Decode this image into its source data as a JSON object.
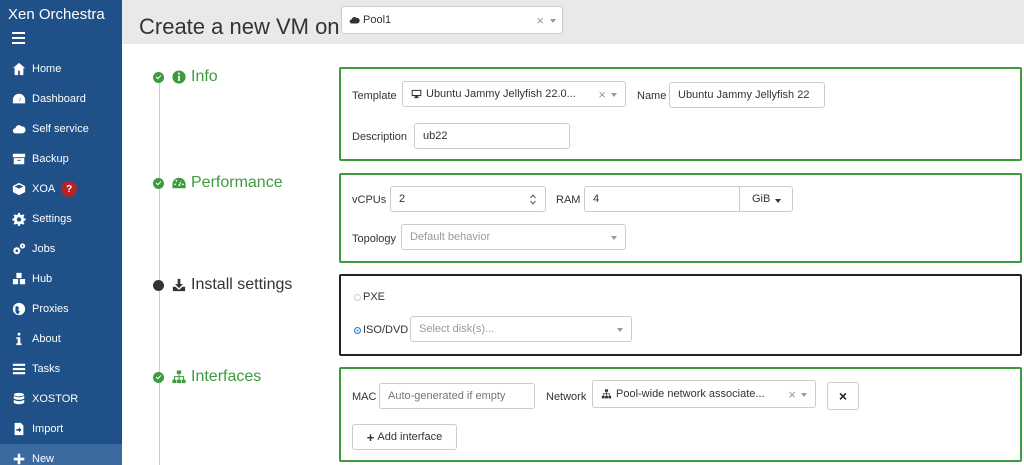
{
  "app": {
    "brand": "Xen Orchestra"
  },
  "sidebar": {
    "items": [
      {
        "label": "Home",
        "icon": "home-icon"
      },
      {
        "label": "Dashboard",
        "icon": "dashboard-icon"
      },
      {
        "label": "Self service",
        "icon": "cloud-icon"
      },
      {
        "label": "Backup",
        "icon": "archive-icon"
      },
      {
        "label": "XOA",
        "icon": "cube-icon",
        "badge": "?"
      },
      {
        "label": "Settings",
        "icon": "gear-icon"
      },
      {
        "label": "Jobs",
        "icon": "gears-icon"
      },
      {
        "label": "Hub",
        "icon": "cubes-icon"
      },
      {
        "label": "Proxies",
        "icon": "globe-icon"
      },
      {
        "label": "About",
        "icon": "info-icon"
      },
      {
        "label": "Tasks",
        "icon": "tasks-icon"
      },
      {
        "label": "XOSTOR",
        "icon": "database-icon"
      },
      {
        "label": "Import",
        "icon": "import-icon"
      },
      {
        "label": "New",
        "icon": "plus-icon"
      }
    ]
  },
  "header": {
    "title": "Create a new VM on",
    "pool": {
      "value": "Pool1",
      "clear": "×"
    }
  },
  "sections": {
    "info": {
      "title": "Info",
      "template_label": "Template",
      "template_value": "Ubuntu Jammy Jellyfish 22.0...",
      "name_label": "Name",
      "name_value": "Ubuntu Jammy Jellyfish 22",
      "description_label": "Description",
      "description_value": "ub22"
    },
    "performance": {
      "title": "Performance",
      "vcpus_label": "vCPUs",
      "vcpus_value": "2",
      "ram_label": "RAM",
      "ram_value": "4",
      "ram_unit": "GiB",
      "topology_label": "Topology",
      "topology_placeholder": "Default behavior"
    },
    "install": {
      "title": "Install settings",
      "pxe_label": "PXE",
      "iso_label": "ISO/DVD",
      "iso_placeholder": "Select disk(s)...",
      "selected": "ISO/DVD"
    },
    "interfaces": {
      "title": "Interfaces",
      "mac_label": "MAC",
      "mac_placeholder": "Auto-generated if empty",
      "network_label": "Network",
      "network_value": "Pool-wide network associate...",
      "remove_label": "×",
      "add_label": "Add interface"
    }
  },
  "colors": {
    "sidebar": "#1f5087",
    "success": "#3e9a3e",
    "header_bg": "#e9e9eb"
  }
}
